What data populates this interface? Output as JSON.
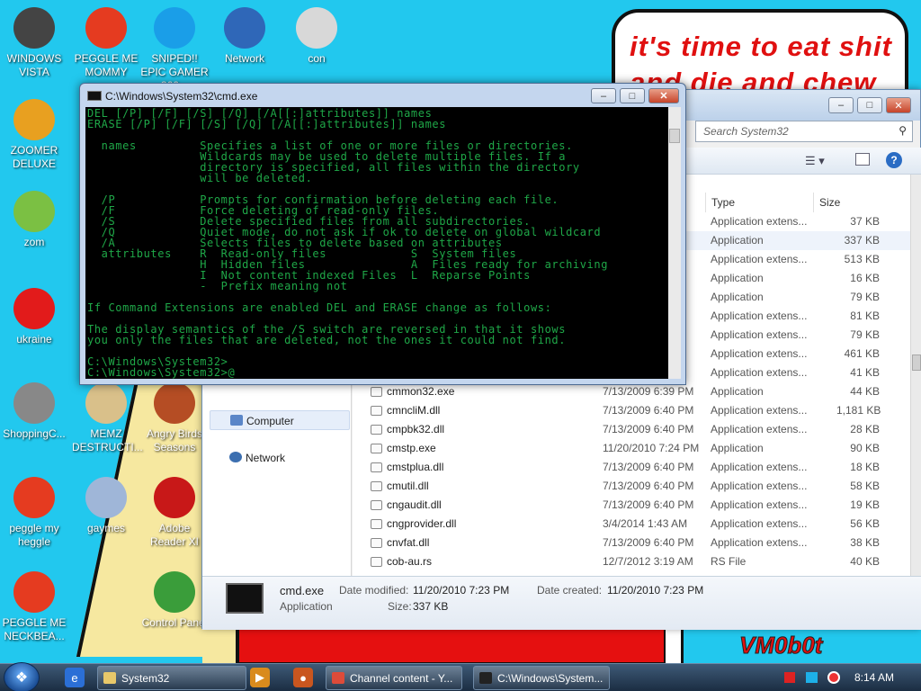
{
  "wallpaper": {
    "quote": "it's time to eat shit",
    "quote2": "and die and chew",
    "signature": "VM0b0t"
  },
  "desktop_icons": [
    {
      "label": "WINDOWS VISTA",
      "icon": "windows-vista-icon",
      "color": "#444"
    },
    {
      "label": "PEGGLE ME MOMMY",
      "icon": "peggle-icon",
      "color": "#e53b20"
    },
    {
      "label": "SNIPED!! EPIC GAMER 360...",
      "icon": "skype-icon",
      "color": "#1a9ee8"
    },
    {
      "label": "Network",
      "icon": "network-icon",
      "color": "#2f67b8"
    },
    {
      "label": "con",
      "icon": "folder-icon",
      "color": "#d8d8d8"
    },
    {
      "label": "ZOOMER DELUXE",
      "icon": "zoomer-icon",
      "color": "#e8a020"
    },
    {
      "label": "zom",
      "icon": "plant-icon",
      "color": "#7bc043"
    },
    {
      "label": "ukraine",
      "icon": "radiation-icon",
      "color": "#e21b1b"
    },
    {
      "label": "ShoppingC...",
      "icon": "flash-icon",
      "color": "#888"
    },
    {
      "label": "MEMZ DESTRUCTI...",
      "icon": "memz-icon",
      "color": "#d9c08a"
    },
    {
      "label": "Angry Birds Seasons",
      "icon": "angry-birds-icon",
      "color": "#b54d24"
    },
    {
      "label": "peggle my heggle",
      "icon": "peggle-icon",
      "color": "#e53b20"
    },
    {
      "label": "gaymes",
      "icon": "games-icon",
      "color": "#9fb6d8"
    },
    {
      "label": "Adobe Reader XI",
      "icon": "adobe-reader-icon",
      "color": "#c81818"
    },
    {
      "label": "PEGGLE ME NECKBEA...",
      "icon": "peggle-icon",
      "color": "#e53b20"
    },
    {
      "label": "Control Panel",
      "icon": "control-panel-icon",
      "color": "#3a9d3a"
    }
  ],
  "explorer": {
    "search_placeholder": "Search System32",
    "col_type": "Type",
    "col_size": "Size",
    "nav": {
      "computer": "Computer",
      "network": "Network"
    },
    "rows": [
      {
        "name": "",
        "date": "",
        "type": "Application extens...",
        "size": "37 KB"
      },
      {
        "name": "",
        "date": "",
        "type": "Application",
        "size": "337 KB",
        "hl": true
      },
      {
        "name": "",
        "date": "",
        "type": "Application extens...",
        "size": "513 KB"
      },
      {
        "name": "",
        "date": "",
        "type": "Application",
        "size": "16 KB"
      },
      {
        "name": "",
        "date": "",
        "type": "Application",
        "size": "79 KB"
      },
      {
        "name": "",
        "date": "",
        "type": "Application extens...",
        "size": "81 KB"
      },
      {
        "name": "",
        "date": "",
        "type": "Application extens...",
        "size": "79 KB"
      },
      {
        "name": "",
        "date": "",
        "type": "Application extens...",
        "size": "461 KB"
      },
      {
        "name": "",
        "date": "",
        "type": "Application extens...",
        "size": "41 KB"
      },
      {
        "name": "cmmon32.exe",
        "date": "7/13/2009 6:39 PM",
        "type": "Application",
        "size": "44 KB"
      },
      {
        "name": "cmncliM.dll",
        "date": "7/13/2009 6:40 PM",
        "type": "Application extens...",
        "size": "1,181 KB"
      },
      {
        "name": "cmpbk32.dll",
        "date": "7/13/2009 6:40 PM",
        "type": "Application extens...",
        "size": "28 KB"
      },
      {
        "name": "cmstp.exe",
        "date": "11/20/2010 7:24 PM",
        "type": "Application",
        "size": "90 KB"
      },
      {
        "name": "cmstplua.dll",
        "date": "7/13/2009 6:40 PM",
        "type": "Application extens...",
        "size": "18 KB"
      },
      {
        "name": "cmutil.dll",
        "date": "7/13/2009 6:40 PM",
        "type": "Application extens...",
        "size": "58 KB"
      },
      {
        "name": "cngaudit.dll",
        "date": "7/13/2009 6:40 PM",
        "type": "Application extens...",
        "size": "19 KB"
      },
      {
        "name": "cngprovider.dll",
        "date": "3/4/2014 1:43 AM",
        "type": "Application extens...",
        "size": "56 KB"
      },
      {
        "name": "cnvfat.dll",
        "date": "7/13/2009 6:40 PM",
        "type": "Application extens...",
        "size": "38 KB"
      },
      {
        "name": "cob-au.rs",
        "date": "12/7/2012 3:19 AM",
        "type": "RS File",
        "size": "40 KB"
      }
    ],
    "details": {
      "name": "cmd.exe",
      "kind": "Application",
      "modified_label": "Date modified:",
      "modified": "11/20/2010 7:23 PM",
      "created_label": "Date created:",
      "created": "11/20/2010 7:23 PM",
      "size_label": "Size:",
      "size": "337 KB"
    }
  },
  "cmd": {
    "title": "C:\\Windows\\System32\\cmd.exe",
    "output": "DEL [/P] [/F] [/S] [/Q] [/A[[:]attributes]] names\nERASE [/P] [/F] [/S] [/Q] [/A[[:]attributes]] names\n\n  names         Specifies a list of one or more files or directories.\n                Wildcards may be used to delete multiple files. If a\n                directory is specified, all files within the directory\n                will be deleted.\n\n  /P            Prompts for confirmation before deleting each file.\n  /F            Force deleting of read-only files.\n  /S            Delete specified files from all subdirectories.\n  /Q            Quiet mode, do not ask if ok to delete on global wildcard\n  /A            Selects files to delete based on attributes\n  attributes    R  Read-only files            S  System files\n                H  Hidden files               A  Files ready for archiving\n                I  Not content indexed Files  L  Reparse Points\n                -  Prefix meaning not\n\nIf Command Extensions are enabled DEL and ERASE change as follows:\n\nThe display semantics of the /S switch are reversed in that it shows\nyou only the files that are deleted, not the ones it could not find.\n\nC:\\Windows\\System32>\nC:\\Windows\\System32>@"
  },
  "taskbar": {
    "buttons": [
      {
        "label": "System32",
        "icon": "folder-icon",
        "color": "#e8c86a"
      },
      {
        "label": "Channel content - Y...",
        "icon": "chrome-icon",
        "color": "#dd4b39"
      },
      {
        "label": "C:\\Windows\\System...",
        "icon": "cmd-icon",
        "color": "#222"
      }
    ],
    "clock": "8:14 AM"
  }
}
